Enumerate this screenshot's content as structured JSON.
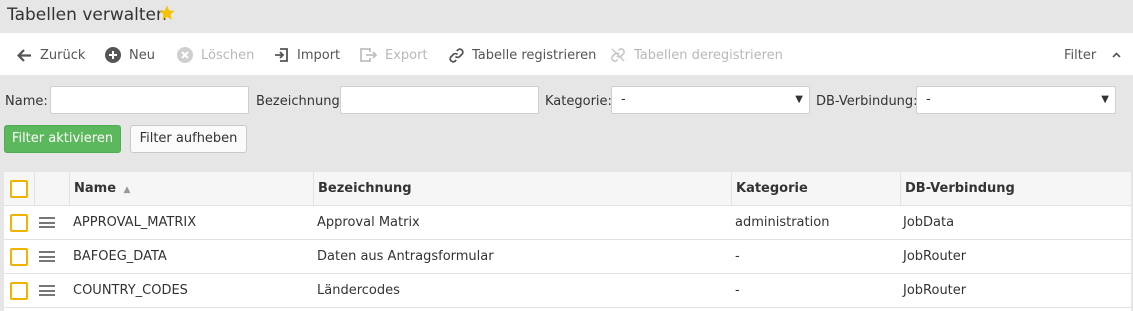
{
  "header": {
    "title": "Tabellen verwalten",
    "favorite_icon": "star-icon",
    "favorite_color": "#f5c200"
  },
  "toolbar": {
    "back_label": "Zurück",
    "new_label": "Neu",
    "delete_label": "Löschen",
    "import_label": "Import",
    "export_label": "Export",
    "register_label": "Tabelle registrieren",
    "deregister_label": "Tabellen deregistrieren",
    "filter_label": "Filter"
  },
  "filter": {
    "name_label": "Name:",
    "name_value": "",
    "designation_label": "Bezeichnung:",
    "designation_value": "",
    "category_label": "Kategorie:",
    "category_value": "-",
    "db_label": "DB-Verbindung:",
    "db_value": "-",
    "apply_label": "Filter aktivieren",
    "reset_label": "Filter aufheben",
    "apply_color": "#5cb85c"
  },
  "table": {
    "columns": [
      "Name",
      "Bezeichnung",
      "Kategorie",
      "DB-Verbindung"
    ],
    "sort_column": "Name",
    "sort_direction": "ascending",
    "rows": [
      {
        "name": "APPROVAL_MATRIX",
        "designation": "Approval Matrix",
        "category": "administration",
        "db": "JobData"
      },
      {
        "name": "BAFOEG_DATA",
        "designation": "Daten aus Antragsformular",
        "category": "-",
        "db": "JobRouter"
      },
      {
        "name": "COUNTRY_CODES",
        "designation": "Ländercodes",
        "category": "-",
        "db": "JobRouter"
      }
    ],
    "checkbox_color": "#f0b400"
  }
}
